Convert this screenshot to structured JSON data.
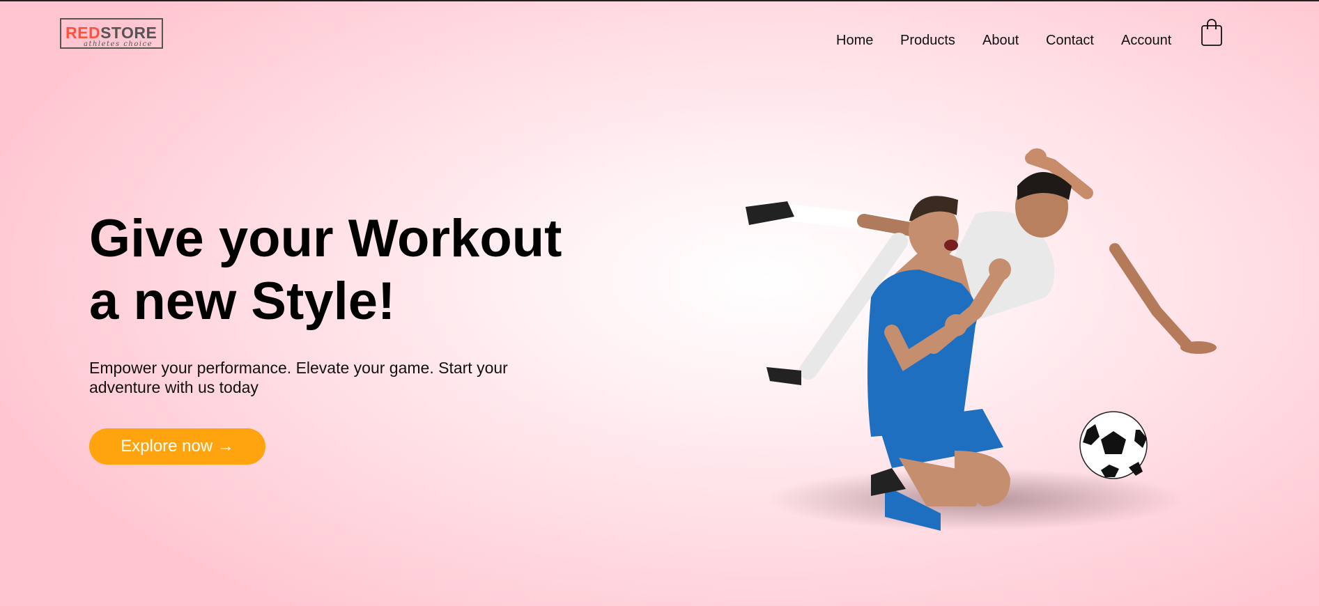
{
  "brand": {
    "name_red": "RED",
    "name_dark": "STORE",
    "tagline": "athletes choice",
    "accent": "#ff523b"
  },
  "nav": {
    "items": [
      {
        "label": "Home"
      },
      {
        "label": "Products"
      },
      {
        "label": "About"
      },
      {
        "label": "Contact"
      },
      {
        "label": "Account"
      }
    ],
    "cart_icon": "shopping-bag-icon"
  },
  "hero": {
    "title_line1": "Give your Workout",
    "title_line2": "a new Style!",
    "subtitle": "Empower your performance. Elevate your game. Start your adventure with us today",
    "cta_label": "Explore now →",
    "cta_color": "#ffa40e",
    "image": "two-football-players-with-ball"
  }
}
